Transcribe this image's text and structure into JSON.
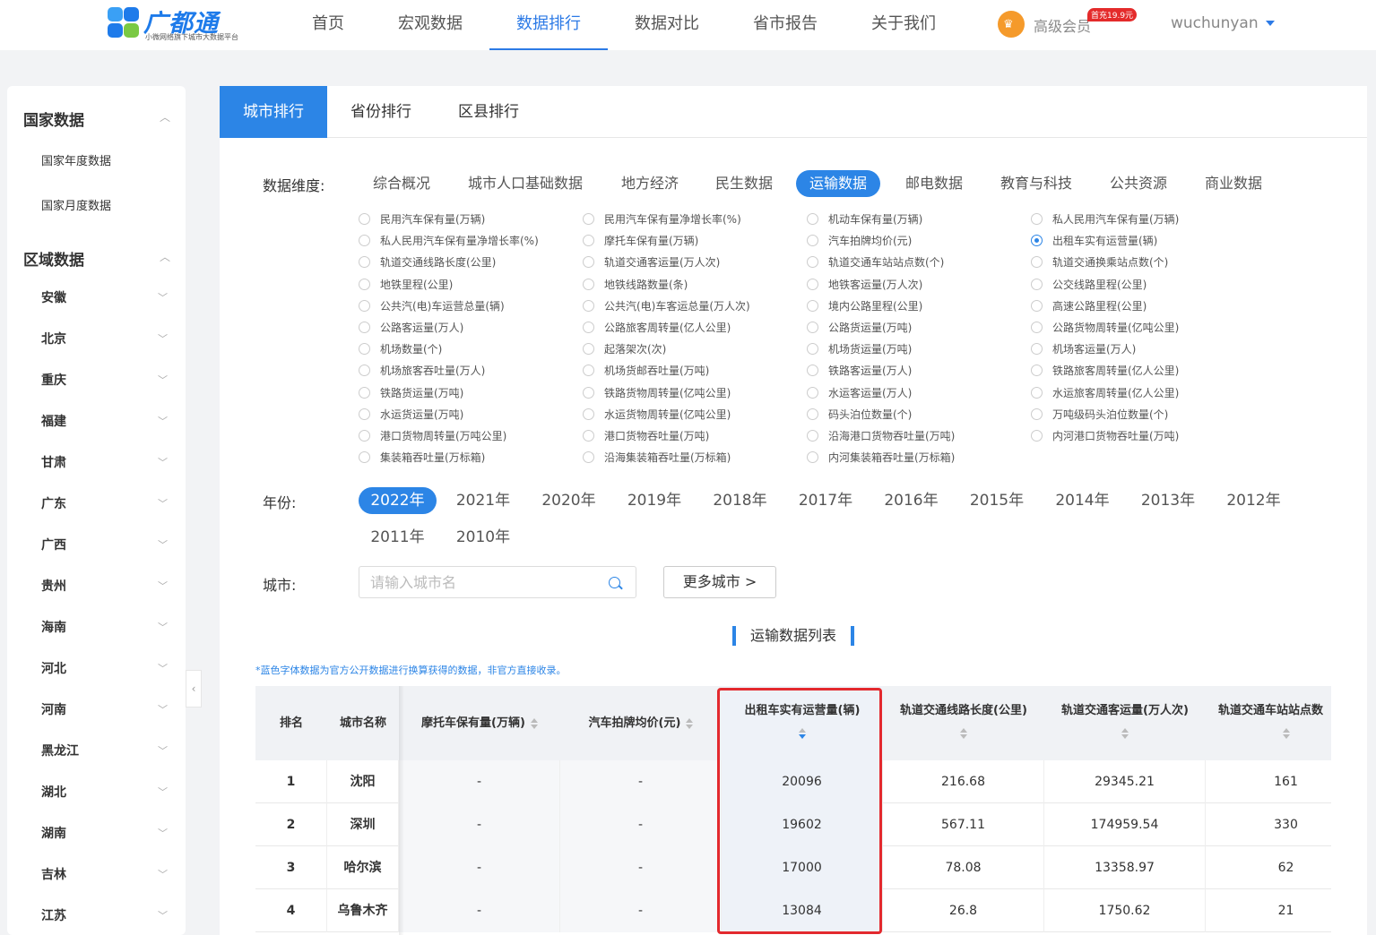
{
  "brand": {
    "name": "广都通",
    "slogan": "小微网络旗下城市大数据平台"
  },
  "nav": [
    "首页",
    "宏观数据",
    "数据排行",
    "数据对比",
    "省市报告",
    "关于我们"
  ],
  "nav_active": "数据排行",
  "vip": {
    "label": "高级会员",
    "badge": "首充19.9元"
  },
  "user": {
    "name": "wuchunyan"
  },
  "sidebar": {
    "national": {
      "title": "国家数据",
      "items": [
        "国家年度数据",
        "国家月度数据"
      ]
    },
    "regional": {
      "title": "区域数据",
      "items": [
        "安徽",
        "北京",
        "重庆",
        "福建",
        "甘肃",
        "广东",
        "广西",
        "贵州",
        "海南",
        "河北",
        "河南",
        "黑龙江",
        "湖北",
        "湖南",
        "吉林",
        "江苏"
      ]
    }
  },
  "tabs": [
    "城市排行",
    "省份排行",
    "区县排行"
  ],
  "filters": {
    "dimension_label": "数据维度:",
    "dimensions": [
      "综合概况",
      "城市人口基础数据",
      "地方经济",
      "民生数据",
      "运输数据",
      "邮电数据",
      "教育与科技",
      "公共资源",
      "商业数据"
    ],
    "dimension_active": "运输数据",
    "indicators": [
      [
        "民用汽车保有量(万辆)",
        "民用汽车保有量净增长率(%)",
        "机动车保有量(万辆)",
        "私人民用汽车保有量(万辆)"
      ],
      [
        "私人民用汽车保有量净增长率(%)",
        "摩托车保有量(万辆)",
        "汽车拍牌均价(元)",
        "出租车实有运营量(辆)"
      ],
      [
        "轨道交通线路长度(公里)",
        "轨道交通客运量(万人次)",
        "轨道交通车站站点数(个)",
        "轨道交通换乘站点数(个)"
      ],
      [
        "地铁里程(公里)",
        "地铁线路数量(条)",
        "地铁客运量(万人次)",
        "公交线路里程(公里)"
      ],
      [
        "公共汽(电)车运营总量(辆)",
        "公共汽(电)车客运总量(万人次)",
        "境内公路里程(公里)",
        "高速公路里程(公里)"
      ],
      [
        "公路客运量(万人)",
        "公路旅客周转量(亿人公里)",
        "公路货运量(万吨)",
        "公路货物周转量(亿吨公里)"
      ],
      [
        "机场数量(个)",
        "起落架次(次)",
        "机场货运量(万吨)",
        "机场客运量(万人)"
      ],
      [
        "机场旅客吞吐量(万人)",
        "机场货邮吞吐量(万吨)",
        "铁路客运量(万人)",
        "铁路旅客周转量(亿人公里)"
      ],
      [
        "铁路货运量(万吨)",
        "铁路货物周转量(亿吨公里)",
        "水运客运量(万人)",
        "水运旅客周转量(亿人公里)"
      ],
      [
        "水运货运量(万吨)",
        "水运货物周转量(亿吨公里)",
        "码头泊位数量(个)",
        "万吨级码头泊位数量(个)"
      ],
      [
        "港口货物周转量(万吨公里)",
        "港口货物吞吐量(万吨)",
        "沿海港口货物吞吐量(万吨)",
        "内河港口货物吞吐量(万吨)"
      ],
      [
        "集装箱吞吐量(万标箱)",
        "沿海集装箱吞吐量(万标箱)",
        "内河集装箱吞吐量(万标箱)",
        ""
      ]
    ],
    "indicator_selected": "出租车实有运营量(辆)",
    "year_label": "年份:",
    "years": [
      "2022年",
      "2021年",
      "2020年",
      "2019年",
      "2018年",
      "2017年",
      "2016年",
      "2015年",
      "2014年",
      "2013年",
      "2012年",
      "2011年",
      "2010年"
    ],
    "year_active": "2022年",
    "city_label": "城市:",
    "city_placeholder": "请输入城市名",
    "more_cities": "更多城市 >"
  },
  "list_title": "运输数据列表",
  "note": "*蓝色字体数据为官方公开数据进行换算获得的数据，非官方直接收录。",
  "table": {
    "columns": [
      "排名",
      "城市名称",
      "摩托车保有量(万辆)",
      "汽车拍牌均价(元)",
      "出租车实有运营量(辆)",
      "轨道交通线路长度(公里)",
      "轨道交通客运量(万人次)",
      "轨道交通车站站点数"
    ],
    "rows": [
      [
        "1",
        "沈阳",
        "-",
        "-",
        "20096",
        "216.68",
        "29345.21",
        "161"
      ],
      [
        "2",
        "深圳",
        "-",
        "-",
        "19602",
        "567.11",
        "174959.54",
        "330"
      ],
      [
        "3",
        "哈尔滨",
        "-",
        "-",
        "17000",
        "78.08",
        "13358.97",
        "62"
      ],
      [
        "4",
        "乌鲁木齐",
        "-",
        "-",
        "13084",
        "26.8",
        "1750.62",
        "21"
      ]
    ]
  },
  "colors": {
    "accent": "#2c85e6",
    "highlight_border": "#e3292e",
    "vip_orange": "#f59a2b",
    "badge_red": "#e42b2b"
  },
  "icons": [
    "brand-logo-icon",
    "crown-icon",
    "caret-down-icon",
    "chevron-up-icon",
    "chevron-down-icon",
    "chevron-left-icon",
    "search-icon",
    "sort-icon"
  ]
}
